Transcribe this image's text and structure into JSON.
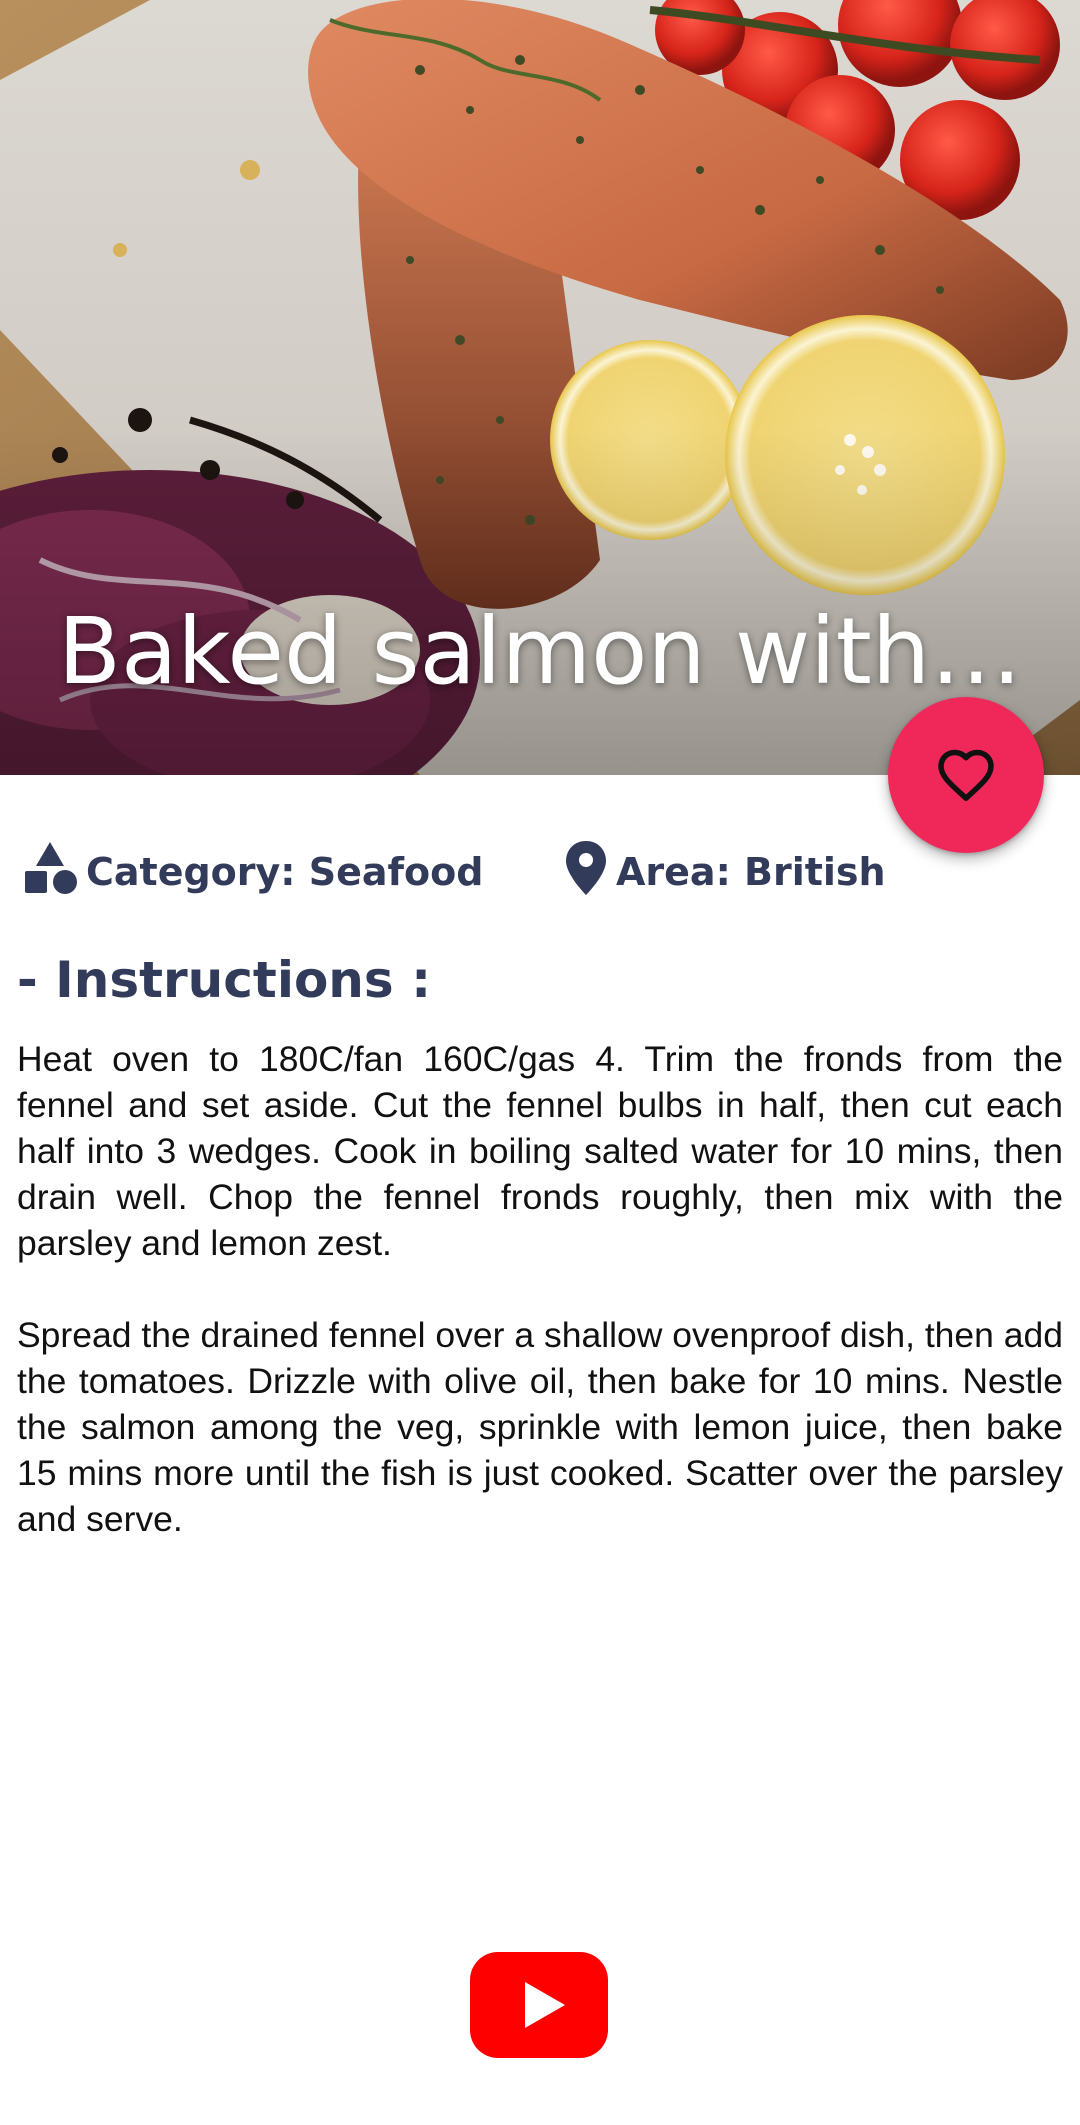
{
  "recipe": {
    "title": "Baked salmon with…",
    "category_text": "Category: Seafood",
    "area_text": "Area: British",
    "instructions_heading": "- Instructions :",
    "instructions": [
      "Heat oven to 180C/fan 160C/gas 4. Trim the fronds from the fennel and set aside. Cut the fennel bulbs in half, then cut each half into 3 wedges. Cook in boiling salted water for 10 mins, then drain well. Chop the fennel fronds roughly, then mix with the parsley and lemon zest.",
      "Spread the drained fennel over a shallow ovenproof dish, then add the tomatoes. Drizzle with olive oil, then bake for 10 mins. Nestle the salmon among the veg, sprinkle with lemon juice, then bake 15 mins more until the fish is just cooked. Scatter over the parsley and serve."
    ]
  },
  "icons": {
    "favorite": "heart-outline-icon",
    "category": "shapes-icon",
    "area": "map-pin-icon",
    "video": "youtube-icon"
  },
  "colors": {
    "fab": "#f0285a",
    "meta_text": "#323c5a",
    "body_text": "#111111",
    "youtube_red": "#ff0000"
  }
}
